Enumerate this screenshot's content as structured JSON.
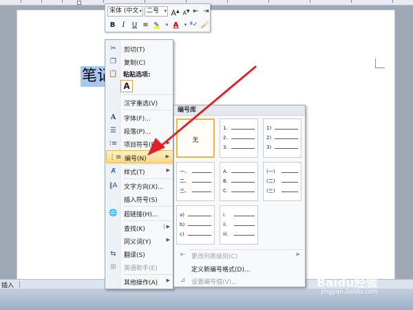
{
  "status_bar": {
    "mode": "插入"
  },
  "document": {
    "selected_text": "笔记"
  },
  "mini_toolbar": {
    "font_name": "宋体 (中文",
    "font_size": "二号",
    "grow_font": "A",
    "shrink_font": "A",
    "bold": "B",
    "italic": "I",
    "underline": "U",
    "font_color": "A"
  },
  "context_menu": {
    "cut": "剪切(T)",
    "copy": "复制(C)",
    "paste_options": "粘贴选项:",
    "paste_keep": "A",
    "reconvert": "汉字重选(V)",
    "font": "字体(F)...",
    "paragraph": "段落(P)...",
    "bullets": "项目符号(B)",
    "numbering": "编号(N)",
    "styles": "样式(T)",
    "text_direction": "文字方向(X)...",
    "insert_symbol": "插入符号(S)",
    "hyperlink": "超链接(H)...",
    "lookup": "查找(K)",
    "synonyms": "同义词(Y)",
    "translate": "翻译(S)",
    "english_assistant": "英语助手(E)",
    "more_actions": "其他操作(A)"
  },
  "numbering_submenu": {
    "title": "编号库",
    "none_label": "无",
    "formats": [
      {
        "items": [
          "1.",
          "2.",
          "3."
        ]
      },
      {
        "items": [
          "1)",
          "2)",
          "3)"
        ]
      },
      {
        "items": [
          "一、",
          "二、",
          "三、"
        ]
      },
      {
        "items": [
          "A.",
          "B.",
          "C."
        ]
      },
      {
        "items": [
          "(一)",
          "(二)",
          "(三)"
        ]
      },
      {
        "items": [
          "a)",
          "b)",
          "c)"
        ]
      },
      {
        "items": [
          "i.",
          "ii.",
          "iii."
        ]
      }
    ],
    "change_level": "更改列表级别(C)",
    "define_new": "定义新编号格式(D)...",
    "set_value": "设置编号值(V)..."
  },
  "watermark": {
    "logo": "Baidu经验",
    "url": "jingyan.baidu.com"
  },
  "colors": {
    "highlight": "#a8c8ee",
    "menu_hover": "#f8d985",
    "arrow": "#e0212a"
  }
}
